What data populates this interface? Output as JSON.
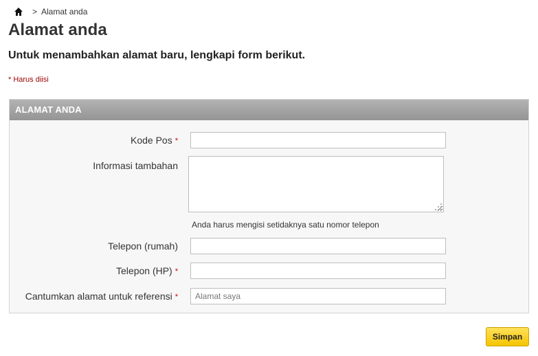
{
  "breadcrumb": {
    "home_icon": "home-icon",
    "separator": ">",
    "current": "Alamat anda"
  },
  "page": {
    "title": "Alamat anda",
    "subtitle": "Untuk menambahkan alamat baru, lengkapi form berikut.",
    "required_note": "* Harus diisi"
  },
  "panel": {
    "header": "ALAMAT ANDA",
    "fields": {
      "postcode": {
        "label": "Kode Pos",
        "required_mark": "*",
        "value": ""
      },
      "additional_info": {
        "label": "Informasi tambahan",
        "value": ""
      },
      "phone_hint": "Anda harus mengisi setidaknya satu nomor telepon",
      "phone_home": {
        "label": "Telepon (rumah)",
        "value": ""
      },
      "phone_mobile": {
        "label": "Telepon (HP)",
        "required_mark": "*",
        "value": ""
      },
      "alias": {
        "label": "Cantumkan alamat untuk referensi",
        "required_mark": "*",
        "placeholder": "Alamat saya",
        "value": ""
      }
    }
  },
  "actions": {
    "save_label": "Simpan"
  },
  "colors": {
    "header_bg": "#a5a5a5",
    "required": "#cc0000",
    "button_bg": "#f5c400"
  }
}
